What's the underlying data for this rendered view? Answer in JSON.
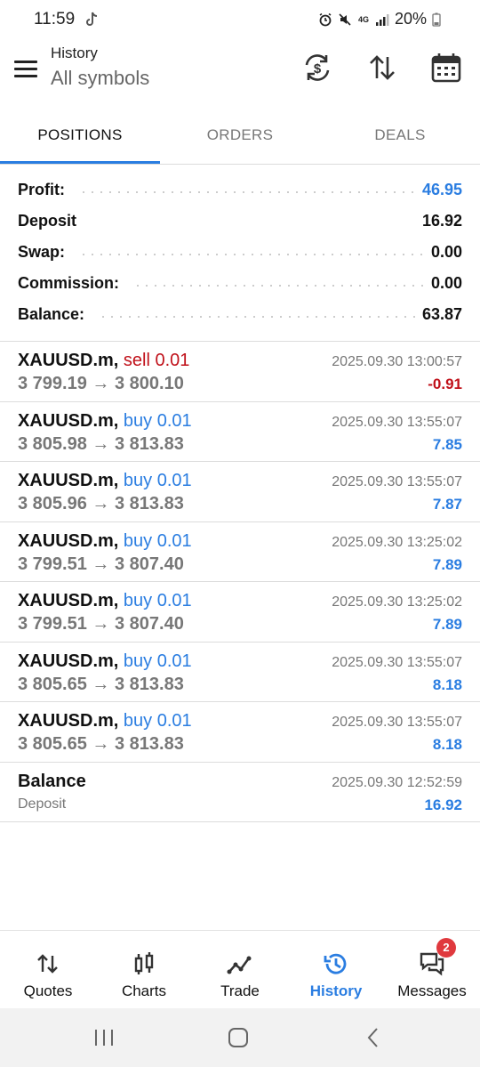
{
  "status": {
    "time": "11:59",
    "network": "4G",
    "battery": "20%"
  },
  "header": {
    "title": "History",
    "subtitle": "All symbols",
    "icons": [
      "menu-icon",
      "currency-exchange-icon",
      "sort-icon",
      "calendar-icon"
    ]
  },
  "tabs": [
    {
      "label": "POSITIONS",
      "active": true
    },
    {
      "label": "ORDERS",
      "active": false
    },
    {
      "label": "DEALS",
      "active": false
    }
  ],
  "summary": [
    {
      "label": "Profit:",
      "value": "46.95",
      "highlight": true
    },
    {
      "label": "Deposit",
      "value": "16.92",
      "highlight": false
    },
    {
      "label": "Swap:",
      "value": "0.00",
      "highlight": false
    },
    {
      "label": "Commission:",
      "value": "0.00",
      "highlight": false
    },
    {
      "label": "Balance:",
      "value": "63.87",
      "highlight": false
    }
  ],
  "positions": [
    {
      "symbol": "XAUUSD.m,",
      "side": "sell 0.01",
      "prices": "3 799.19 → 3 800.10",
      "date": "2025.09.30 13:00:57",
      "profit": "-0.91"
    },
    {
      "symbol": "XAUUSD.m,",
      "side": "buy 0.01",
      "prices": "3 805.98 → 3 813.83",
      "date": "2025.09.30 13:55:07",
      "profit": "7.85"
    },
    {
      "symbol": "XAUUSD.m,",
      "side": "buy 0.01",
      "prices": "3 805.96 → 3 813.83",
      "date": "2025.09.30 13:55:07",
      "profit": "7.87"
    },
    {
      "symbol": "XAUUSD.m,",
      "side": "buy 0.01",
      "prices": "3 799.51 → 3 807.40",
      "date": "2025.09.30 13:25:02",
      "profit": "7.89"
    },
    {
      "symbol": "XAUUSD.m,",
      "side": "buy 0.01",
      "prices": "3 799.51 → 3 807.40",
      "date": "2025.09.30 13:25:02",
      "profit": "7.89"
    },
    {
      "symbol": "XAUUSD.m,",
      "side": "buy 0.01",
      "prices": "3 805.65 → 3 813.83",
      "date": "2025.09.30 13:55:07",
      "profit": "8.18"
    },
    {
      "symbol": "XAUUSD.m,",
      "side": "buy 0.01",
      "prices": "3 805.65 → 3 813.83",
      "date": "2025.09.30 13:55:07",
      "profit": "8.18"
    }
  ],
  "balance_entry": {
    "title": "Balance",
    "subtitle": "Deposit",
    "date": "2025.09.30 12:52:59",
    "amount": "16.92"
  },
  "bottom_nav": [
    {
      "label": "Quotes",
      "icon": "quotes-icon",
      "active": false
    },
    {
      "label": "Charts",
      "icon": "charts-icon",
      "active": false
    },
    {
      "label": "Trade",
      "icon": "trade-icon",
      "active": false
    },
    {
      "label": "History",
      "icon": "history-icon",
      "active": true
    },
    {
      "label": "Messages",
      "icon": "messages-icon",
      "active": false,
      "badge": "2"
    }
  ],
  "colors": {
    "accent": "#2a7de1",
    "sell": "#c0111a",
    "badge": "#e0393e"
  }
}
